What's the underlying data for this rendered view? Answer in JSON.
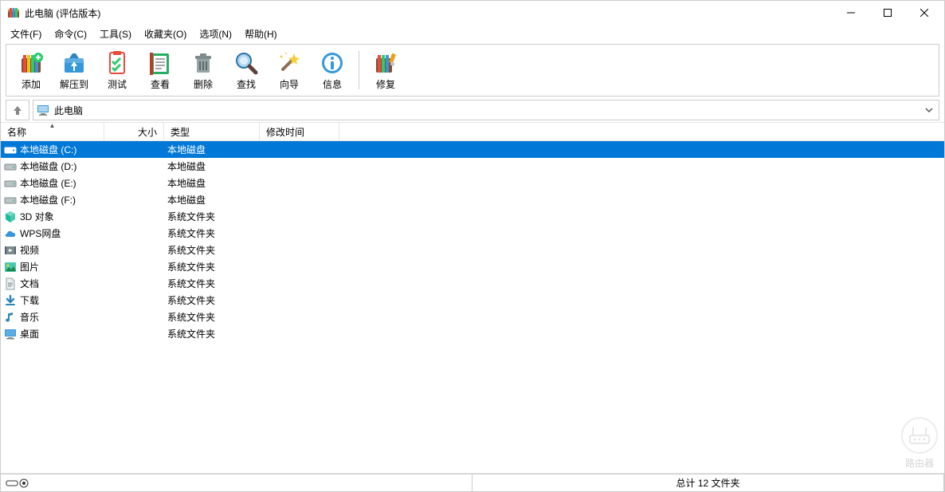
{
  "window": {
    "title": "此电脑 (评估版本)"
  },
  "menu": {
    "file": "文件(F)",
    "cmd": "命令(C)",
    "tool": "工具(S)",
    "fav": "收藏夹(O)",
    "opt": "选项(N)",
    "help": "帮助(H)"
  },
  "toolbar": {
    "add": "添加",
    "extract": "解压到",
    "test": "测试",
    "view": "查看",
    "delete": "删除",
    "find": "查找",
    "wizard": "向导",
    "info": "信息",
    "repair": "修复"
  },
  "address": {
    "path": "此电脑"
  },
  "columns": {
    "name": "名称",
    "size": "大小",
    "type": "类型",
    "modified": "修改时间"
  },
  "rows": [
    {
      "icon": "drive-c",
      "name": "本地磁盘 (C:)",
      "type": "本地磁盘",
      "selected": true
    },
    {
      "icon": "drive",
      "name": "本地磁盘 (D:)",
      "type": "本地磁盘"
    },
    {
      "icon": "drive",
      "name": "本地磁盘 (E:)",
      "type": "本地磁盘"
    },
    {
      "icon": "drive",
      "name": "本地磁盘 (F:)",
      "type": "本地磁盘"
    },
    {
      "icon": "3d",
      "name": "3D 对象",
      "type": "系统文件夹"
    },
    {
      "icon": "cloud",
      "name": "WPS网盘",
      "type": "系统文件夹"
    },
    {
      "icon": "video",
      "name": "视频",
      "type": "系统文件夹"
    },
    {
      "icon": "picture",
      "name": "图片",
      "type": "系统文件夹"
    },
    {
      "icon": "doc",
      "name": "文档",
      "type": "系统文件夹"
    },
    {
      "icon": "download",
      "name": "下载",
      "type": "系统文件夹"
    },
    {
      "icon": "music",
      "name": "音乐",
      "type": "系统文件夹"
    },
    {
      "icon": "desktop",
      "name": "桌面",
      "type": "系统文件夹"
    }
  ],
  "status": {
    "total": "总计 12 文件夹"
  },
  "watermark": {
    "text": "路由器"
  }
}
